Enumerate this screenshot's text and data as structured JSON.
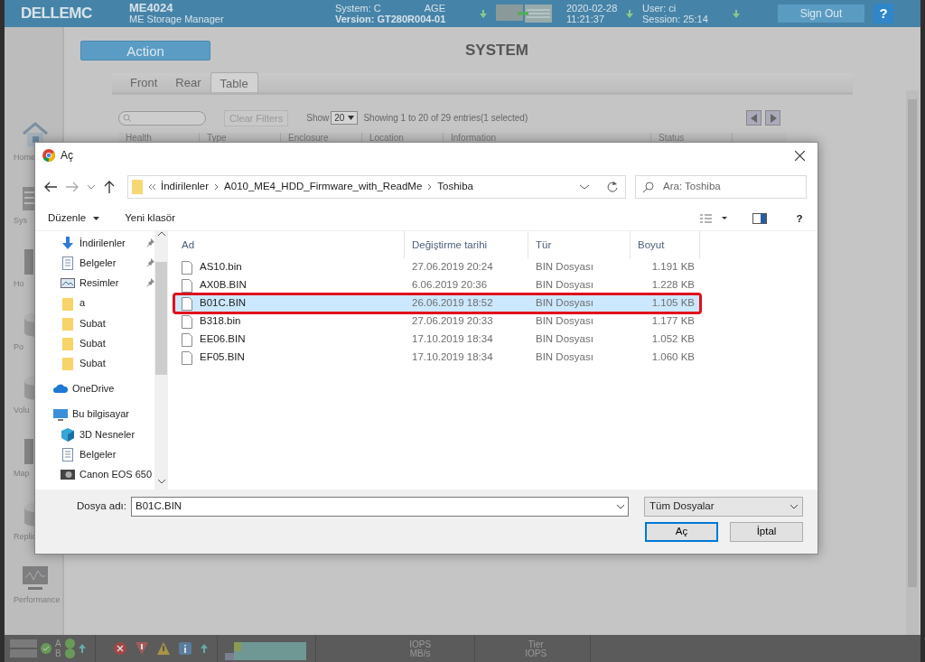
{
  "header": {
    "logo": "DELLEMC",
    "product": "ME4024",
    "subtitle": "ME Storage Manager",
    "system": "System: C",
    "system_tail": "AGE",
    "version": "Version: GT280R004-01",
    "date": "2020-02-28",
    "time": "11:21:37",
    "user": "User: ci",
    "session": "Session: 25:14",
    "sign_out": "Sign Out",
    "help": "?"
  },
  "sidebar": {
    "items": [
      {
        "label": "Home",
        "kind": "home"
      },
      {
        "label": "Sys",
        "kind": "rack"
      },
      {
        "label": "Ho",
        "kind": "tower"
      },
      {
        "label": "Po",
        "kind": "disk"
      },
      {
        "label": "Volu",
        "kind": "disk"
      },
      {
        "label": "Map",
        "kind": "tower"
      },
      {
        "label": "Replic",
        "kind": "disk"
      },
      {
        "label": "Performance",
        "kind": "monitor"
      }
    ]
  },
  "action_button": "Action",
  "page_title": "SYSTEM",
  "tabs": [
    {
      "label": "Front",
      "selected": false
    },
    {
      "label": "Rear",
      "selected": false
    },
    {
      "label": "Table",
      "selected": true
    }
  ],
  "filters": {
    "clear": "Clear Filters",
    "show": "Show",
    "page_size": "20",
    "summary": "Showing 1 to 20 of 29 entries(1 selected)"
  },
  "table": {
    "columns": [
      "Health",
      "Type",
      "Enclosure",
      "Location",
      "Information",
      "Status"
    ]
  },
  "dialog": {
    "title": "Aç",
    "breadcrumb": [
      "İndirilenler",
      "A010_ME4_HDD_Firmware_with_ReadMe",
      "Toshiba"
    ],
    "search": {
      "placeholder": "Ara: Toshiba"
    },
    "toolbar": {
      "organize": "Düzenle",
      "new_folder": "Yeni klasör",
      "help": "?"
    },
    "nav": [
      {
        "label": "İndirilenler",
        "kind": "download",
        "pinned": true
      },
      {
        "label": "Belgeler",
        "kind": "document",
        "pinned": true
      },
      {
        "label": "Resimler",
        "kind": "picture",
        "pinned": true
      },
      {
        "label": "a",
        "kind": "folder",
        "pinned": false
      },
      {
        "label": "Subat",
        "kind": "folder",
        "pinned": false
      },
      {
        "label": "Subat",
        "kind": "folder",
        "pinned": false
      },
      {
        "label": "Subat",
        "kind": "folder",
        "pinned": false
      },
      {
        "label": "OneDrive",
        "kind": "cloud",
        "pinned": false
      },
      {
        "label": "Bu bilgisayar",
        "kind": "computer",
        "pinned": false,
        "children": [
          {
            "label": "3D Nesneler",
            "kind": "cube",
            "pinned": false
          },
          {
            "label": "Belgeler",
            "kind": "document",
            "pinned": false
          },
          {
            "label": "Canon EOS 650",
            "kind": "camera",
            "pinned": false
          }
        ]
      }
    ],
    "columns": [
      "Ad",
      "Değiştirme tarihi",
      "Tür",
      "Boyut"
    ],
    "files": [
      {
        "name": "AS10.bin",
        "date": "27.06.2019 20:24",
        "type": "BIN Dosyası",
        "size": "1.191 KB",
        "selected": false,
        "marked": false
      },
      {
        "name": "AX0B.BIN",
        "date": "6.06.2019 20:36",
        "type": "BIN Dosyası",
        "size": "1.228 KB",
        "selected": false,
        "marked": false
      },
      {
        "name": "B01C.BIN",
        "date": "26.06.2019 18:52",
        "type": "BIN Dosyası",
        "size": "1.105 KB",
        "selected": true,
        "marked": true
      },
      {
        "name": "B318.bin",
        "date": "27.06.2019 20:33",
        "type": "BIN Dosyası",
        "size": "1.177 KB",
        "selected": false,
        "marked": false
      },
      {
        "name": "EE06.BIN",
        "date": "17.10.2019 18:34",
        "type": "BIN Dosyası",
        "size": "1.052 KB",
        "selected": false,
        "marked": false
      },
      {
        "name": "EF05.BIN",
        "date": "17.10.2019 18:34",
        "type": "BIN Dosyası",
        "size": "1.060 KB",
        "selected": false,
        "marked": false
      }
    ],
    "filename_label": "Dosya adı:",
    "filename": "B01C.BIN",
    "filter": "Tüm Dosyalar",
    "open_button": "Aç",
    "cancel_button": "İptal"
  },
  "status_bar": {
    "controllers": [
      {
        "label": "A",
        "ok": true
      },
      {
        "label": "B",
        "ok": true
      }
    ],
    "metrics": [
      [
        "IOPS",
        "MB/s"
      ],
      [
        "Tier",
        "IOPS"
      ]
    ]
  }
}
